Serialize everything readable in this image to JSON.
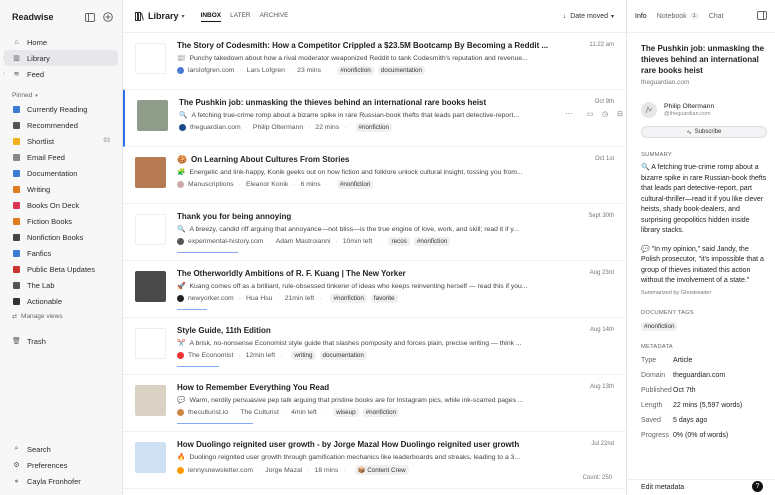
{
  "app": {
    "logo": "Readwise"
  },
  "sidebar": {
    "top": [
      {
        "label": "Home",
        "icon": "home-icon"
      },
      {
        "label": "Library",
        "icon": "library-icon",
        "active": true
      },
      {
        "label": "Feed",
        "icon": "feed-icon"
      }
    ],
    "pinned_label": "Pinned",
    "pinned": [
      {
        "label": "Currently Reading",
        "icon": "book-icon",
        "color": "#3a7bd5"
      },
      {
        "label": "Recommended",
        "icon": "recommend-icon",
        "color": "#555"
      },
      {
        "label": "Shortlist",
        "icon": "star-icon",
        "color": "#f2b01e",
        "count": "93"
      },
      {
        "label": "Email Feed",
        "icon": "email-icon",
        "color": "#888"
      },
      {
        "label": "Documentation",
        "icon": "doc-icon",
        "color": "#3a7bd5"
      },
      {
        "label": "Writing",
        "icon": "pen-icon",
        "color": "#e07b20"
      },
      {
        "label": "Books On Deck",
        "icon": "books-icon",
        "color": "#d35"
      },
      {
        "label": "Fiction Books",
        "icon": "fiction-icon",
        "color": "#e07b20"
      },
      {
        "label": "Nonfiction Books",
        "icon": "nonfiction-icon",
        "color": "#444"
      },
      {
        "label": "Fanfics",
        "icon": "fanfics-icon",
        "color": "#3a7bd5"
      },
      {
        "label": "Public Beta Updates",
        "icon": "updates-icon",
        "color": "#c33"
      },
      {
        "label": "The Lab",
        "icon": "lab-icon",
        "color": "#555"
      },
      {
        "label": "Actionable",
        "icon": "check-icon",
        "color": "#333"
      }
    ],
    "manage_views": "Manage views",
    "trash": "Trash",
    "bottom": [
      {
        "label": "Search",
        "icon": "search-icon"
      },
      {
        "label": "Preferences",
        "icon": "gear-icon"
      },
      {
        "label": "Cayla Fronhofer",
        "icon": "avatar-icon"
      }
    ]
  },
  "main": {
    "title": "Library",
    "tabs": [
      "INBOX",
      "LATER",
      "ARCHIVE"
    ],
    "active_tab": "INBOX",
    "sort_label": "Date moved",
    "count": "Count: 250",
    "rows": [
      {
        "title": "The Story of Codesmith: How a Competitor Crippled a $23.5M Bootcamp By Becoming a Reddit ...",
        "desc": "Punchy takedown about how a rival moderator weaponized Reddit to tank Codesmith's reputation and revenue...",
        "emoji": "📰",
        "domain": "larslofgren.com",
        "author": "Lars Lofgren",
        "length": "23 mins",
        "tags": [
          "#nonfiction",
          "documentation"
        ],
        "date": "11:22 am",
        "thumb": "#ffffff",
        "fav": "#4a7bd0"
      },
      {
        "title": "The Pushkin job: unmasking the thieves behind an international rare books heist",
        "desc": "A fetching true-crime romp about a bizarre spike in rare Russian-book thefts that leads part detective-report...",
        "emoji": "🔍",
        "domain": "theguardian.com",
        "author": "Philip Oltermann",
        "length": "22 mins",
        "tags": [
          "#nonfiction"
        ],
        "date": "Oct 9th",
        "thumb": "#8f9c8a",
        "fav": "#1a4a8a",
        "selected": true
      },
      {
        "title": "On Learning About Cultures From Stories",
        "desc": "Energetic and link-happy, Konik geeks out on how fiction and folklore unlock cultural insight, tossing you from...",
        "emoji": "🧩",
        "domain": "Manuscriptions",
        "author": "Eleanor Konik",
        "length": "6 mins",
        "tags": [
          "#nonfiction"
        ],
        "date": "Oct 1st",
        "thumb": "#b57a52",
        "fav": "#caa",
        "title_emoji": "🍪"
      },
      {
        "title": "Thank you for being annoying",
        "desc": "A breezy, candid riff arguing that annoyance—not bliss—is the true engine of love, work, and skill; read it if y...",
        "emoji": "🔍",
        "domain": "experimental-history.com",
        "author": "Adam Mastroianni",
        "length": "10min left",
        "tags": [
          "recos",
          "#nonfiction"
        ],
        "date": "Sept 30th",
        "thumb": "#ffffff",
        "fav": "#555",
        "progress": 0.16
      },
      {
        "title": "The Otherworldly Ambitions of R. F. Kuang | The New Yorker",
        "desc": "Kuang comes off as a brilliant, rule-obsessed tinkerer of ideas who keeps reinventing herself — read this if you...",
        "emoji": "🚀",
        "domain": "newyorker.com",
        "author": "Hua Hsu",
        "length": "21min left",
        "tags": [
          "#nonfiction",
          "favorite"
        ],
        "date": "Aug 23rd",
        "thumb": "#4a4a4a",
        "fav": "#222",
        "progress": 0.08
      },
      {
        "title": "Style Guide, 11th Edition",
        "desc": "A brisk, no-nonsense Economist style guide that slashes pomposity and forces plain, precise writing — think ...",
        "emoji": "✂️",
        "domain": "The Economist",
        "author": "",
        "length": "12min left",
        "tags": [
          "writing",
          "documentation"
        ],
        "date": "Aug 14th",
        "thumb": "#ffffff",
        "fav": "#e33",
        "progress": 0.11
      },
      {
        "title": "How to Remember Everything You Read",
        "desc": "Warm, nerdily persuasive pep talk arguing that pristine books are for Instagram pics, while ink-scarred pages ...",
        "emoji": "💬",
        "domain": "theculturist.io",
        "author": "The Culturist",
        "length": "4min left",
        "tags": [
          "wiseup",
          "#nonfiction"
        ],
        "date": "Aug 13th",
        "thumb": "#d9d2c4",
        "fav": "#c84",
        "progress": 0.2
      },
      {
        "title": "How Duolingo reignited user growth - by Jorge Mazal How Duolingo reignited user growth",
        "desc": "Duolingo reignited user growth through gamification mechanics like leaderboards and streaks, leading to a 3...",
        "emoji": "🔥",
        "domain": "lennysnewsletter.com",
        "author": "Jorge Mazal",
        "length": "18 mins",
        "tags": [
          "📦 Content Crew"
        ],
        "date": "Jul 22nd",
        "thumb": "#cfe0f3",
        "fav": "#f90"
      }
    ]
  },
  "panel": {
    "tabs": [
      {
        "label": "Info",
        "active": true
      },
      {
        "label": "Notebook",
        "badge": "1"
      },
      {
        "label": "Chat"
      }
    ],
    "title": "The Pushkin job: unmasking the thieves behind an international rare books heist",
    "domain": "theguardian.com",
    "author_name": "Philip Oltermann",
    "author_handle": "@theguardian.com",
    "subscribe": "Subscribe",
    "summary_label": "SUMMARY",
    "summary_1": "🔍 A fetching true-crime romp about a bizarre spike in rare Russian-book thefts that leads part detective-report, part cultural-thriller—read it if you like clever heists, shady book-dealers, and surprising geopolitics hidden inside library stacks.",
    "summary_2": "💬 \"In my opinion,\" said Jandy, the Polish prosecutor, \"it's impossible that a group of thieves initiated this action without the involvement of a state.\"",
    "summarized_by": "Summarized by Ghostreader",
    "doc_tags_label": "DOCUMENT TAGS",
    "doc_tag": "#nonfiction",
    "metadata_label": "METADATA",
    "metadata": [
      {
        "k": "Type",
        "v": "Article"
      },
      {
        "k": "Domain",
        "v": "theguardian.com"
      },
      {
        "k": "Published",
        "v": "Oct 7th"
      },
      {
        "k": "Length",
        "v": "22 mins (5,597 words)"
      },
      {
        "k": "Saved",
        "v": "5 days ago"
      },
      {
        "k": "Progress",
        "v": "0% (0% of words)"
      }
    ],
    "edit_metadata": "Edit metadata",
    "help": "?"
  }
}
